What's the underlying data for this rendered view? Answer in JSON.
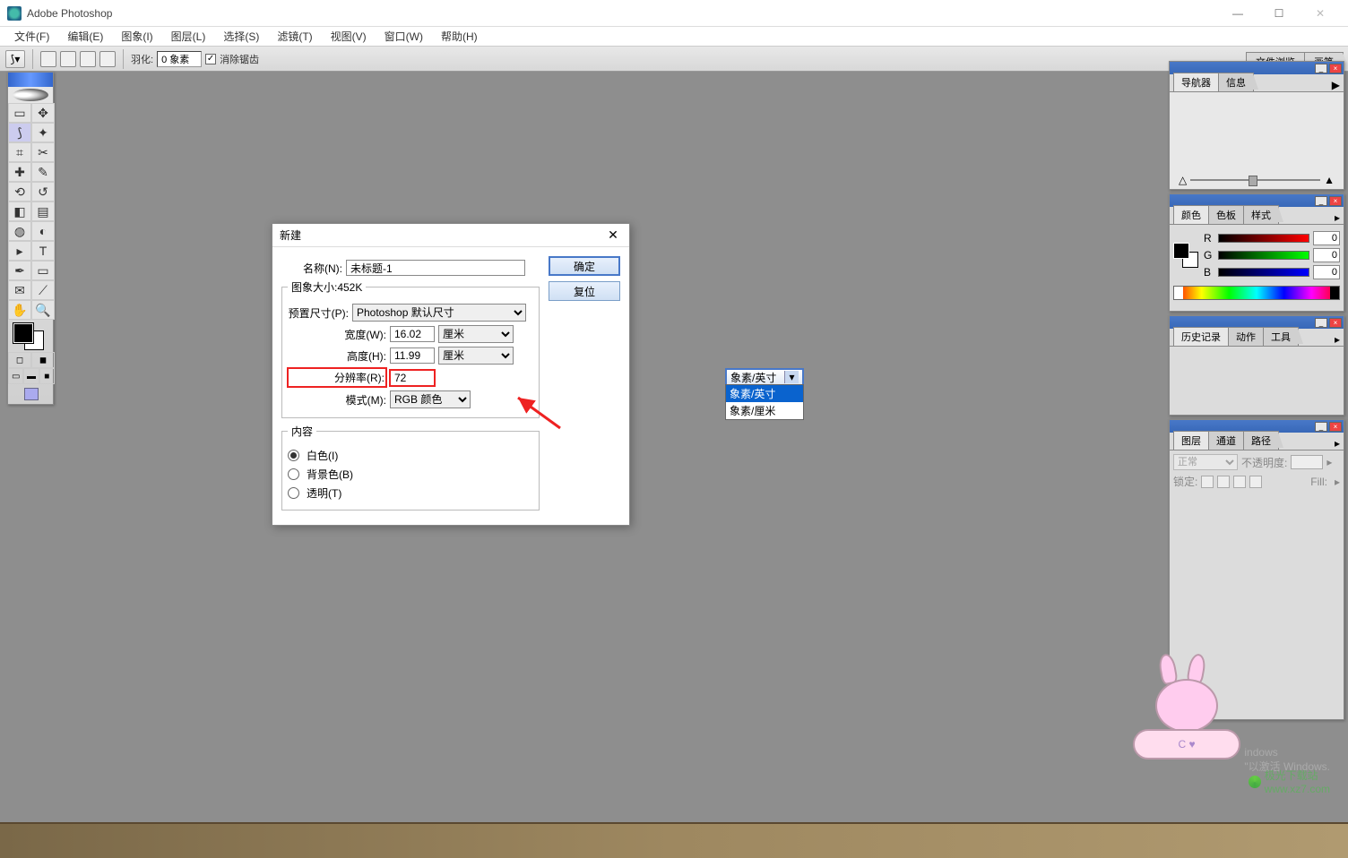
{
  "titlebar": {
    "app_name": "Adobe Photoshop"
  },
  "window_controls": {
    "min": "—",
    "max": "☐",
    "close": "✕"
  },
  "menubar": {
    "file": "文件(F)",
    "edit": "编辑(E)",
    "image": "图象(I)",
    "layer": "图层(L)",
    "select": "选择(S)",
    "filter": "滤镜(T)",
    "view": "视图(V)",
    "window": "窗口(W)",
    "help": "帮助(H)"
  },
  "optbar": {
    "feather_label": "羽化:",
    "feather_value": "0 象素",
    "antialias": "消除锯齿",
    "antialias_checked": "✓",
    "tabs": {
      "file_browser": "文件浏览",
      "brush": "画笔"
    }
  },
  "panels": {
    "navigator": {
      "tab_nav": "导航器",
      "tab_info": "信息",
      "menu": "▶",
      "zoom_small": "△",
      "zoom_large": "▲"
    },
    "color": {
      "tab_color": "颜色",
      "tab_swatches": "色板",
      "tab_styles": "样式",
      "r_label": "R",
      "g_label": "G",
      "b_label": "B",
      "r_val": "0",
      "g_val": "0",
      "b_val": "0"
    },
    "history": {
      "tab_history": "历史记录",
      "tab_actions": "动作",
      "tab_tools": "工具"
    },
    "layers": {
      "tab_layers": "图层",
      "tab_channels": "通道",
      "tab_paths": "路径",
      "blend_mode": "正常",
      "opacity_label": "不透明度:",
      "lock_label": "锁定:",
      "fill_label": "Fill:"
    }
  },
  "dialog": {
    "title": "新建",
    "name_label": "名称(N):",
    "name_value": "未标题-1",
    "ok": "确定",
    "reset": "复位",
    "size_legend": "图象大小:452K",
    "preset_label": "预置尺寸(P):",
    "preset_value": "Photoshop 默认尺寸",
    "width_label": "宽度(W):",
    "width_value": "16.02",
    "width_unit": "厘米",
    "height_label": "高度(H):",
    "height_value": "11.99",
    "height_unit": "厘米",
    "res_label": "分辨率(R):",
    "res_value": "72",
    "res_unit": "象素/英寸",
    "res_options": {
      "ppi": "象素/英寸",
      "ppcm": "象素/厘米"
    },
    "mode_label": "模式(M):",
    "mode_value": "RGB 颜色",
    "contents_legend": "内容",
    "white": "白色(I)",
    "bgcolor": "背景色(B)",
    "transparent": "透明(T)"
  },
  "watermark": {
    "line1": "indows",
    "line2": "\"以激活 Windows.",
    "site_brand": "极光下载站",
    "site_url": "www.xz7.com",
    "mascot_letters": "C ♥"
  },
  "icons": {
    "lasso": "⟆",
    "dropdown_arrow": "▾",
    "panel_menu": "▸"
  }
}
